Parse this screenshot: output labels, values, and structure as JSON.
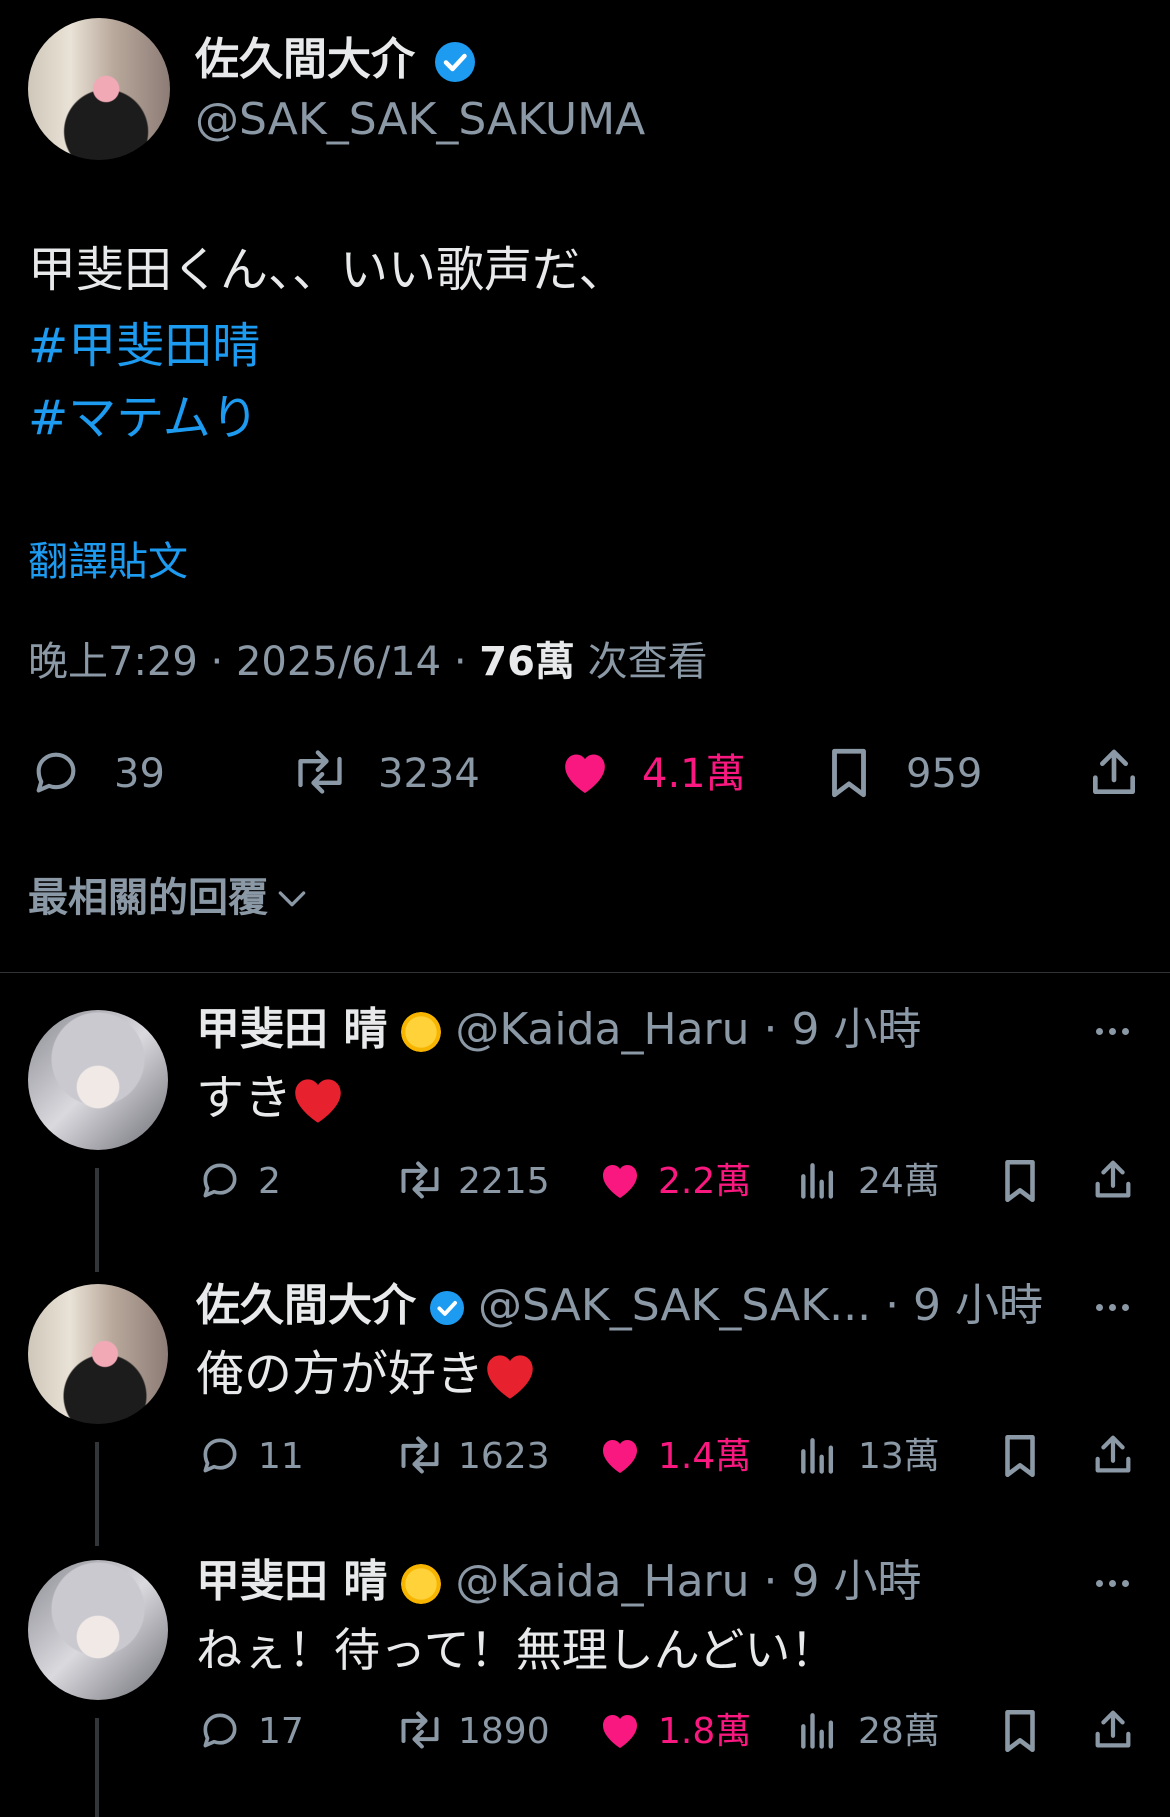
{
  "tweet": {
    "author_name": "佐久間大介",
    "author_handle": "@SAK_SAK_SAKUMA",
    "text_line1": "甲斐田くん、、いい歌声だ、",
    "hashtag1": "#甲斐田晴",
    "hashtag2": "#マテムり",
    "translate_label": "翻譯貼文",
    "time": "晚上7:29",
    "date": "2025/6/14",
    "separator": "·",
    "views_count": "76萬",
    "views_label": "次查看",
    "replies": "39",
    "retweets": "3234",
    "likes": "4.1萬",
    "bookmarks": "959"
  },
  "sort": {
    "label": "最相關的回覆"
  },
  "replies": [
    {
      "name": "甲斐田 晴",
      "handle": "@Kaida_Haru",
      "time": "· 9 小時",
      "text": "すき",
      "replies": "2",
      "retweets": "2215",
      "likes": "2.2萬",
      "views": "24萬"
    },
    {
      "name": "佐久間大介",
      "handle": "@SAK_SAK_SAK...",
      "time": "· 9 小時",
      "text": "俺の方が好き",
      "replies": "11",
      "retweets": "1623",
      "likes": "1.4萬",
      "views": "13萬"
    },
    {
      "name": "甲斐田 晴",
      "handle": "@Kaida_Haru",
      "time": "· 9 小時",
      "text": "ねぇ！待って！無理しんどい！",
      "replies": "17",
      "retweets": "1890",
      "likes": "1.8萬",
      "views": "28萬"
    }
  ],
  "colors": {
    "background": "#000000",
    "text": "#e7e9ea",
    "secondary": "#8b98a5",
    "link": "#1d9bf0",
    "like": "#f91880"
  }
}
